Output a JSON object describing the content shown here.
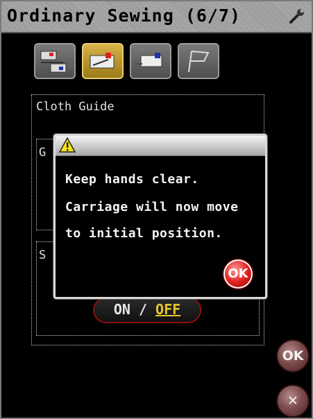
{
  "header": {
    "title": "Ordinary Sewing (6/7)",
    "icon": "wrench-icon"
  },
  "tabs": [
    {
      "name": "stitch-setup",
      "active": false
    },
    {
      "name": "machine",
      "active": true
    },
    {
      "name": "carriage",
      "active": false
    },
    {
      "name": "finish-flag",
      "active": false
    }
  ],
  "panel": {
    "title": "Cloth Guide",
    "sub1_label": "G",
    "sub2_label": "S",
    "toggle": {
      "on": "ON",
      "sep": " / ",
      "off": "OFF",
      "selected": "OFF"
    }
  },
  "side_buttons": {
    "ok_label": "OK",
    "close_label": "✕"
  },
  "dialog": {
    "icon": "warning-icon",
    "lines": [
      "Keep hands clear.",
      "Carriage will now move",
      "to initial position."
    ],
    "ok_label": "OK"
  },
  "colors": {
    "active_tab": "#c9a23a",
    "dialog_ok": "#e02020",
    "toggle_selected": "#e7c62a"
  }
}
